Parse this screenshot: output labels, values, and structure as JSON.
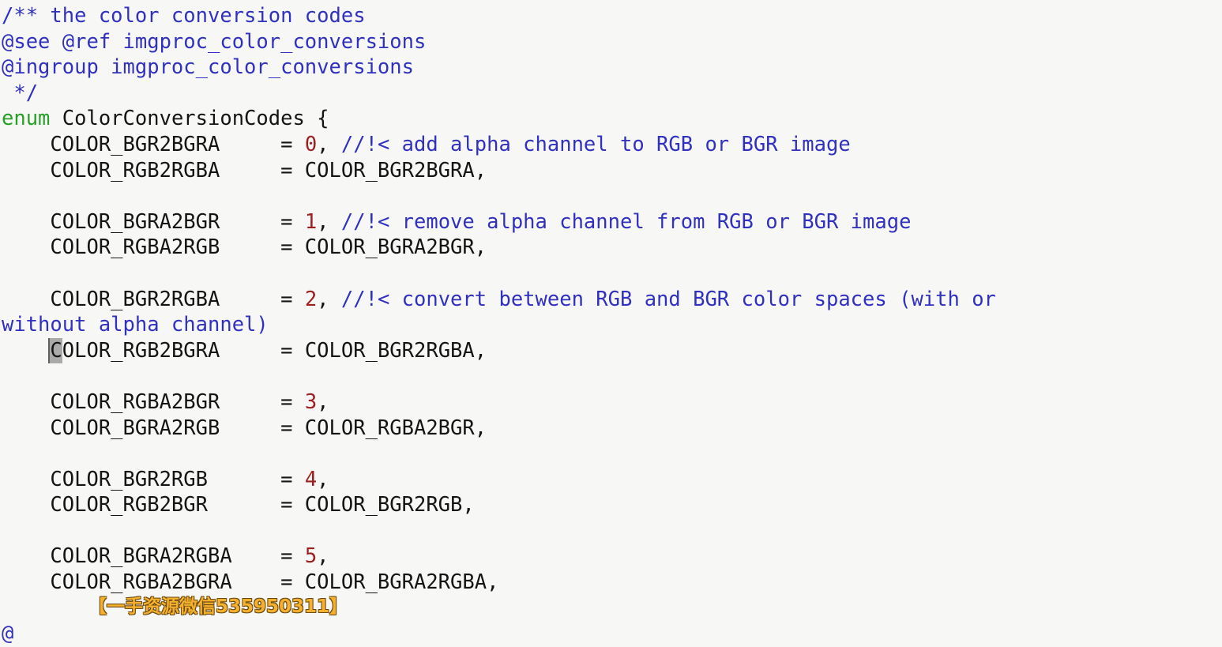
{
  "editor": {
    "language": "cpp",
    "background_color": "#f7f7f5",
    "colors": {
      "comment": "#3131bf",
      "keyword": "#26a026",
      "number": "#9c2020",
      "plain": "#141414",
      "cursor": "#aaaaaa",
      "watermark": "#f5b02e"
    },
    "cursor": {
      "line": 11,
      "column": 5,
      "char": "C"
    },
    "lines": [
      {
        "n": 1,
        "segments": [
          {
            "cls": "tok-comment",
            "text": "/** the color conversion codes"
          }
        ]
      },
      {
        "n": 2,
        "segments": [
          {
            "cls": "tok-comment",
            "text": "@see @ref imgproc_color_conversions"
          }
        ]
      },
      {
        "n": 3,
        "segments": [
          {
            "cls": "tok-comment",
            "text": "@ingroup imgproc_color_conversions"
          }
        ]
      },
      {
        "n": 4,
        "segments": [
          {
            "cls": "tok-comment",
            "text": " */"
          }
        ]
      },
      {
        "n": 5,
        "segments": [
          {
            "cls": "tok-keyword",
            "text": "enum"
          },
          {
            "cls": "tok-plain",
            "text": " ColorConversionCodes {"
          }
        ]
      },
      {
        "n": 6,
        "segments": [
          {
            "cls": "tok-plain",
            "text": "    COLOR_BGR2BGRA     = "
          },
          {
            "cls": "tok-number",
            "text": "0"
          },
          {
            "cls": "tok-plain",
            "text": ", "
          },
          {
            "cls": "tok-comment",
            "text": "//!< add alpha channel to RGB or BGR image"
          }
        ]
      },
      {
        "n": 7,
        "segments": [
          {
            "cls": "tok-plain",
            "text": "    COLOR_RGB2RGBA     = COLOR_BGR2BGRA,"
          }
        ]
      },
      {
        "n": 8,
        "segments": [
          {
            "cls": "tok-blank",
            "text": " "
          }
        ]
      },
      {
        "n": 9,
        "segments": [
          {
            "cls": "tok-plain",
            "text": "    COLOR_BGRA2BGR     = "
          },
          {
            "cls": "tok-number",
            "text": "1"
          },
          {
            "cls": "tok-plain",
            "text": ", "
          },
          {
            "cls": "tok-comment",
            "text": "//!< remove alpha channel from RGB or BGR image"
          }
        ]
      },
      {
        "n": 10,
        "segments": [
          {
            "cls": "tok-plain",
            "text": "    COLOR_RGBA2RGB     = COLOR_BGRA2BGR,"
          }
        ]
      },
      {
        "n": 11,
        "segments": [
          {
            "cls": "tok-blank",
            "text": " "
          }
        ]
      },
      {
        "n": 12,
        "segments": [
          {
            "cls": "tok-plain",
            "text": "    COLOR_BGR2RGBA     = "
          },
          {
            "cls": "tok-number",
            "text": "2"
          },
          {
            "cls": "tok-plain",
            "text": ", "
          },
          {
            "cls": "tok-comment",
            "text": "//!< convert between RGB and BGR color spaces (with or"
          }
        ]
      },
      {
        "n": 13,
        "wrapped": true,
        "segments": [
          {
            "cls": "tok-comment",
            "text": "without alpha channel)"
          }
        ]
      },
      {
        "n": 14,
        "cursor_at": 4,
        "segments": [
          {
            "cls": "tok-plain",
            "text": "    "
          },
          {
            "cls": "cursor-block",
            "text": "C"
          },
          {
            "cls": "tok-plain",
            "text": "OLOR_RGB2BGRA     = COLOR_BGR2RGBA,"
          }
        ]
      },
      {
        "n": 15,
        "segments": [
          {
            "cls": "tok-blank",
            "text": " "
          }
        ]
      },
      {
        "n": 16,
        "segments": [
          {
            "cls": "tok-plain",
            "text": "    COLOR_RGBA2BGR     = "
          },
          {
            "cls": "tok-number",
            "text": "3"
          },
          {
            "cls": "tok-plain",
            "text": ","
          }
        ]
      },
      {
        "n": 17,
        "segments": [
          {
            "cls": "tok-plain",
            "text": "    COLOR_BGRA2RGB     = COLOR_RGBA2BGR,"
          }
        ]
      },
      {
        "n": 18,
        "segments": [
          {
            "cls": "tok-blank",
            "text": " "
          }
        ]
      },
      {
        "n": 19,
        "segments": [
          {
            "cls": "tok-plain",
            "text": "    COLOR_BGR2RGB      = "
          },
          {
            "cls": "tok-number",
            "text": "4"
          },
          {
            "cls": "tok-plain",
            "text": ","
          }
        ]
      },
      {
        "n": 20,
        "segments": [
          {
            "cls": "tok-plain",
            "text": "    COLOR_RGB2BGR      = COLOR_BGR2RGB,"
          }
        ]
      },
      {
        "n": 21,
        "segments": [
          {
            "cls": "tok-blank",
            "text": " "
          }
        ]
      },
      {
        "n": 22,
        "segments": [
          {
            "cls": "tok-plain",
            "text": "    COLOR_BGRA2RGBA    = "
          },
          {
            "cls": "tok-number",
            "text": "5"
          },
          {
            "cls": "tok-plain",
            "text": ","
          }
        ]
      },
      {
        "n": 23,
        "segments": [
          {
            "cls": "tok-plain",
            "text": "    COLOR_RGBA2BGRA    = COLOR_BGRA2RGBA,"
          }
        ]
      },
      {
        "n": 24,
        "segments": [
          {
            "cls": "tok-blank",
            "text": " "
          }
        ]
      },
      {
        "n": 25,
        "segments": [
          {
            "cls": "tok-comment",
            "text": "@"
          }
        ]
      }
    ]
  },
  "watermark": {
    "text": "【一手资源微信535950311】"
  }
}
